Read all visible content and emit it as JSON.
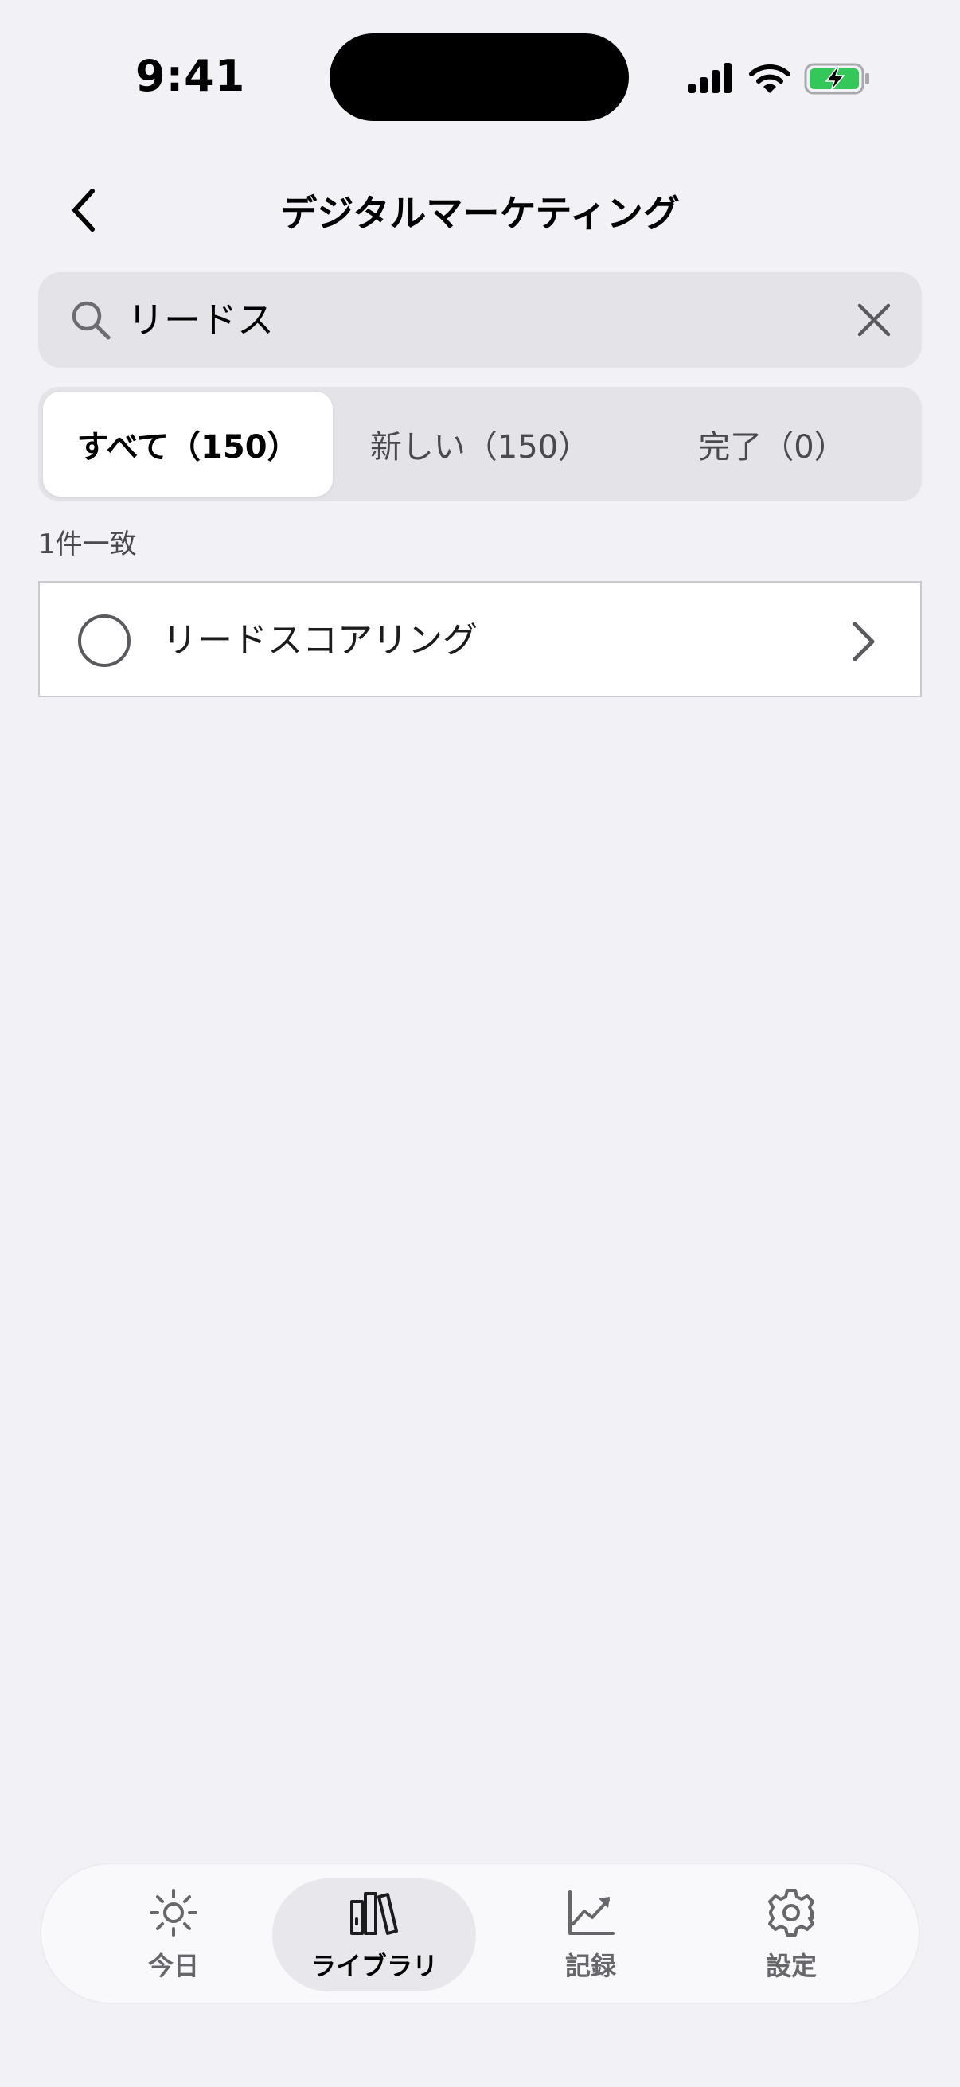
{
  "status_bar": {
    "time": "9:41"
  },
  "header": {
    "title": "デジタルマーケティング"
  },
  "search": {
    "query": "リードス"
  },
  "filter_tabs": [
    {
      "label": "すべて（150）",
      "selected": true
    },
    {
      "label": "新しい（150）",
      "selected": false
    },
    {
      "label": "完了（0）",
      "selected": false
    }
  ],
  "results": {
    "count_text": "1件一致",
    "items": [
      {
        "label": "リードスコアリング",
        "completed": false
      }
    ]
  },
  "tab_bar": [
    {
      "label": "今日",
      "icon": "sun-icon",
      "selected": false
    },
    {
      "label": "ライブラリ",
      "icon": "books-icon",
      "selected": true
    },
    {
      "label": "記録",
      "icon": "chart-icon",
      "selected": false
    },
    {
      "label": "設定",
      "icon": "gear-icon",
      "selected": false
    }
  ],
  "colors": {
    "background": "#f2f1f6",
    "search_bg": "#e3e3e8",
    "battery_green": "#34c759"
  }
}
